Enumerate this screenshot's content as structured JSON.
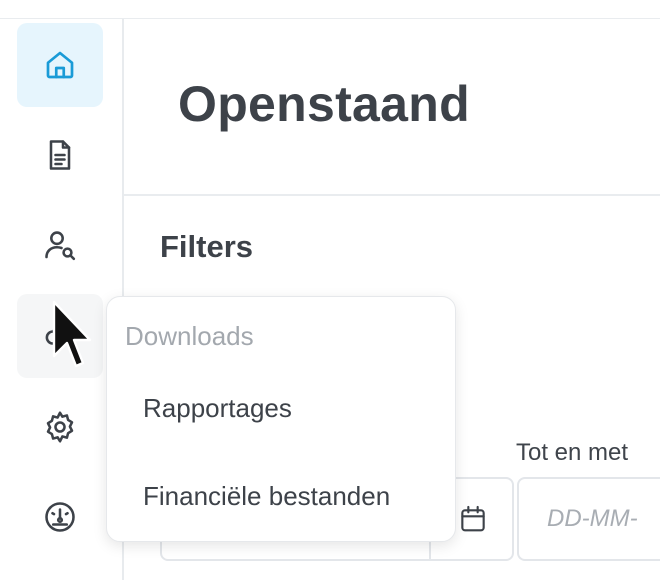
{
  "header": {
    "title": "Openstaand"
  },
  "sidebar": {
    "items": [
      {
        "name": "home",
        "icon": "home-icon",
        "active": true
      },
      {
        "name": "documents",
        "icon": "document-icon",
        "active": false
      },
      {
        "name": "user-search",
        "icon": "user-search-icon",
        "active": false
      },
      {
        "name": "downloads",
        "icon": "download-icon",
        "active": false,
        "hovered": true
      },
      {
        "name": "settings",
        "icon": "gear-icon",
        "active": false
      },
      {
        "name": "dashboard",
        "icon": "gauge-icon",
        "active": false
      }
    ],
    "accent_color": "#1a9bd7"
  },
  "filters": {
    "title": "Filters",
    "date_to_label": "Tot en met",
    "date_to_placeholder": "DD-MM-"
  },
  "downloads_menu": {
    "header": "Downloads",
    "items": [
      "Rapportages",
      "Financiële bestanden"
    ]
  }
}
